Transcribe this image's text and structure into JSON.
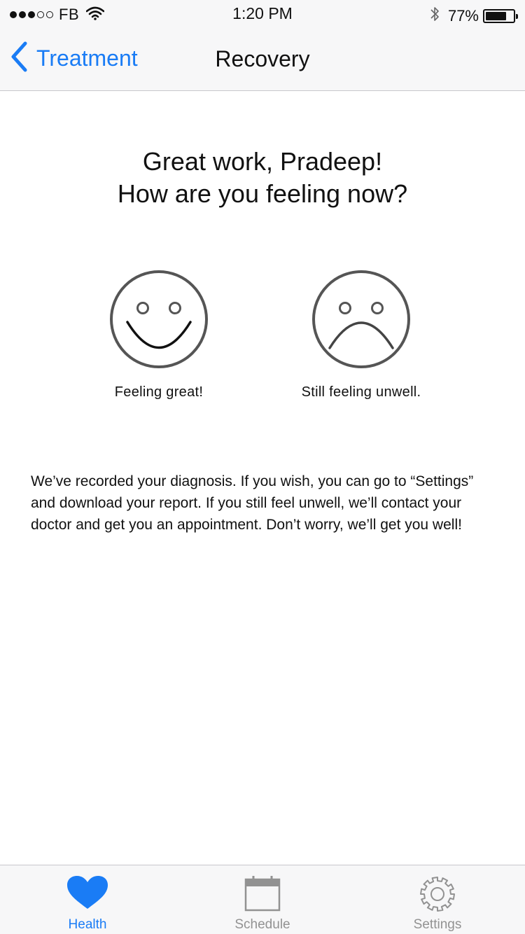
{
  "status_bar": {
    "carrier": "FB",
    "time": "1:20 PM",
    "battery_percent": "77%",
    "battery_level": 0.77,
    "signal_bars_filled": 3,
    "signal_bars_total": 5
  },
  "nav": {
    "back_label": "Treatment",
    "title": "Recovery"
  },
  "greeting": {
    "line1": "Great work, Pradeep!",
    "line2": "How are you feeling now?"
  },
  "options": {
    "happy_label": "Feeling great!",
    "sad_label": "Still feeling unwell."
  },
  "info_text": "We’ve recorded your diagnosis. If you wish, you can go to “Settings” and download your report. If you still feel unwell, we’ll contact your doctor and get you an appointment. Don’t worry, we’ll get you well!",
  "tabs": [
    {
      "label": "Health",
      "icon": "heart-icon",
      "active": true
    },
    {
      "label": "Schedule",
      "icon": "calendar-icon",
      "active": false
    },
    {
      "label": "Settings",
      "icon": "gear-icon",
      "active": false
    }
  ],
  "colors": {
    "accent": "#1a7cf5",
    "inactive": "#929292",
    "bar_background": "#f7f7f8"
  }
}
